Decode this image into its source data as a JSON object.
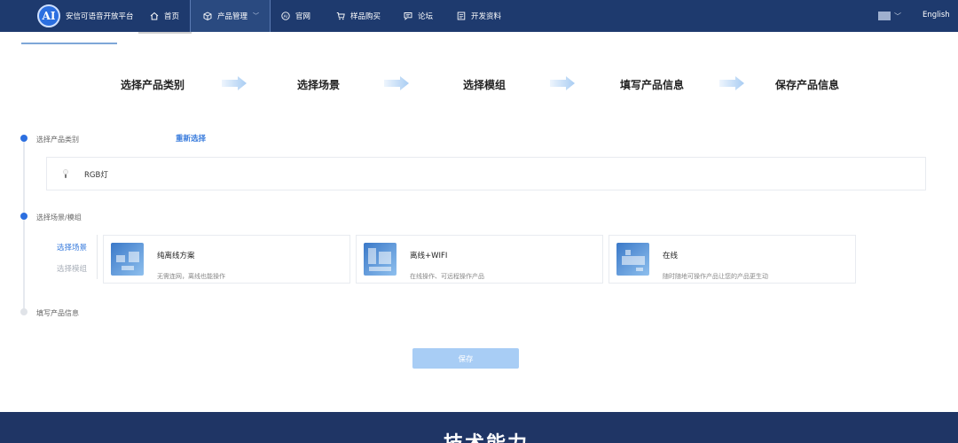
{
  "brand": {
    "logo_text": "AI",
    "name": "安信可语音开放平台"
  },
  "nav": {
    "items": [
      {
        "label": "首页",
        "icon": "home-icon"
      },
      {
        "label": "产品管理",
        "icon": "box-icon",
        "chevron": "﹀"
      },
      {
        "label": "官网",
        "icon": "ai-circle-icon"
      },
      {
        "label": "样品购买",
        "icon": "cart-icon"
      },
      {
        "label": "论坛",
        "icon": "chat-icon"
      },
      {
        "label": "开发资料",
        "icon": "document-icon"
      }
    ],
    "lang_chevron": "﹀",
    "english": "English"
  },
  "steps": [
    "选择产品类别",
    "选择场景",
    "选择模组",
    "填写产品信息",
    "保存产品信息"
  ],
  "sections": {
    "category": {
      "label": "选择产品类别",
      "reselect": "重新选择",
      "selected": "RGB灯"
    },
    "scene": {
      "label": "选择场景/模组",
      "tab_scene": "选择场景",
      "tab_module": "选择模组"
    },
    "info": {
      "label": "填写产品信息"
    }
  },
  "scenes": [
    {
      "title": "纯离线方案",
      "desc": "无需连网，离线也能操作"
    },
    {
      "title": "离线+WIFI",
      "desc": "在线操作、可远程操作产品"
    },
    {
      "title": "在线",
      "desc": "随时随地可操作产品让您的产品更生动"
    }
  ],
  "save_label": "保存",
  "footer": {
    "title": "技术能力"
  },
  "colors": {
    "nav_bg": "#1e3a6e",
    "accent": "#2c6fe0",
    "save_bg": "#a8cdf5",
    "footer_bg": "#1f3565"
  }
}
